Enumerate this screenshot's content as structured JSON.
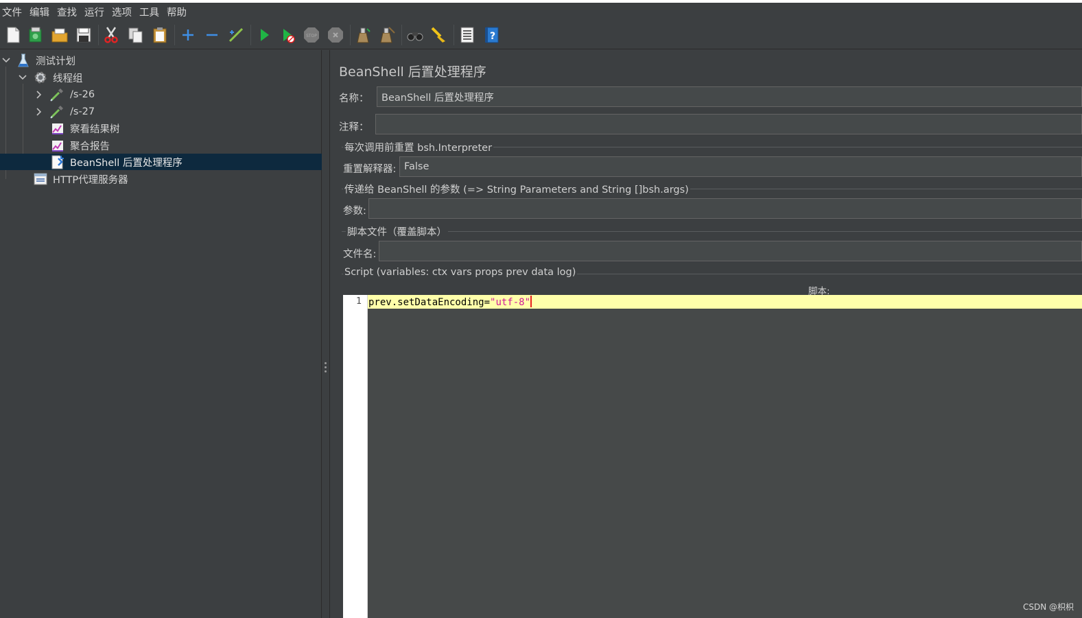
{
  "menu": [
    "文件",
    "编辑",
    "查找",
    "运行",
    "选项",
    "工具",
    "帮助"
  ],
  "toolbar": {
    "buttons": [
      "new-icon",
      "templates-icon",
      "open-icon",
      "save-icon",
      "cut-icon",
      "copy-icon",
      "paste-icon",
      "expand-icon",
      "collapse-icon",
      "toggle-icon",
      "start-icon",
      "start-no-pause-icon",
      "stop-icon",
      "shutdown-icon",
      "clear-icon",
      "clear-all-icon",
      "search-icon",
      "reset-search-icon",
      "function-helper-icon",
      "help-icon"
    ]
  },
  "tree": {
    "items": [
      {
        "label": "测试计划"
      },
      {
        "label": "线程组"
      },
      {
        "label": "/s-26"
      },
      {
        "label": "/s-27"
      },
      {
        "label": "察看结果树"
      },
      {
        "label": "聚合报告"
      },
      {
        "label": "BeanShell 后置处理程序",
        "selected": true
      },
      {
        "label": "HTTP代理服务器"
      }
    ]
  },
  "panel": {
    "title": "BeanShell 后置处理程序",
    "name_label": "名称：",
    "name_value": "BeanShell 后置处理程序",
    "comment_label": "注释：",
    "comment_value": "",
    "reset_group_title": "每次调用前重置 bsh.Interpreter",
    "reset_label": "重置解释器:",
    "reset_value": "False",
    "params_group_title": "传递给 BeanShell 的参数 (=> String Parameters and String []bsh.args)",
    "params_label": "参数:",
    "params_value": "",
    "file_group_title": "脚本文件（覆盖脚本）",
    "file_label": "文件名:",
    "file_value": "",
    "script_group_title": "Script (variables: ctx vars props prev data log)",
    "script_label": "脚本:",
    "script_line_number": "1",
    "script_code_plain": "prev.setDataEncoding=",
    "script_code_string": "\"utf-8\""
  },
  "watermark": "CSDN @枳枳"
}
